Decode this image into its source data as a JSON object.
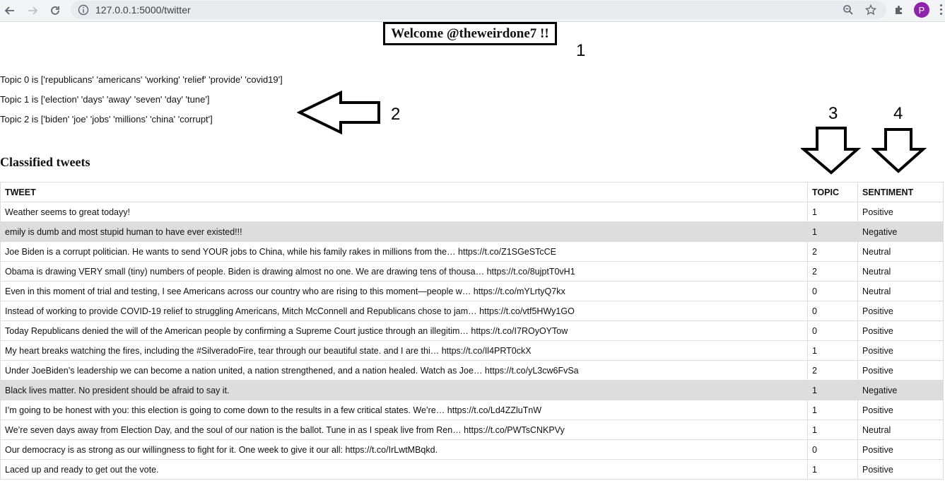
{
  "browser": {
    "url": "127.0.0.1:5000/twitter",
    "avatar_initial": "P"
  },
  "welcome": "Welcome @theweirdone7 !!",
  "annotations": [
    "1",
    "2",
    "3",
    "4"
  ],
  "topics": [
    "Topic 0 is ['republicans' 'americans' 'working' 'relief' 'provide' 'covid19']",
    "Topic 1 is ['election' 'days' 'away' 'seven' 'day' 'tune']",
    "Topic 2 is ['biden' 'joe' 'jobs' 'millions' 'china' 'corrupt']"
  ],
  "section_title": "Classified tweets",
  "table": {
    "headers": [
      "TWEET",
      "TOPIC",
      "SENTIMENT"
    ],
    "rows": [
      {
        "tweet": "Weather seems to great todayy!",
        "topic": "1",
        "sentiment": "Positive"
      },
      {
        "tweet": "emily is dumb and most stupid human to have ever existed!!!",
        "topic": "1",
        "sentiment": "Negative"
      },
      {
        "tweet": "Joe Biden is a corrupt politician. He wants to send YOUR jobs to China, while his family rakes in millions from the… https://t.co/Z1SGeSTcCE",
        "topic": "2",
        "sentiment": "Neutral"
      },
      {
        "tweet": "Obama is drawing VERY small (tiny) numbers of people. Biden is drawing almost no one. We are drawing tens of thousa… https://t.co/8ujptT0vH1",
        "topic": "2",
        "sentiment": "Neutral"
      },
      {
        "tweet": "Even in this moment of trial and testing, I see Americans across our country who are rising to this moment—people w… https://t.co/mYLrtyQ7kx",
        "topic": "0",
        "sentiment": "Neutral"
      },
      {
        "tweet": "Instead of working to provide COVID-19 relief to struggling Americans, Mitch McConnell and Republicans chose to jam… https://t.co/vtf5HWy1GO",
        "topic": "0",
        "sentiment": "Positive"
      },
      {
        "tweet": "Today Republicans denied the will of the American people by confirming a Supreme Court justice through an illegitim… https://t.co/I7ROyOYTow",
        "topic": "0",
        "sentiment": "Positive"
      },
      {
        "tweet": "My heart breaks watching the fires, including the #SilveradoFire, tear through our beautiful state. and I are thi… https://t.co/Il4PRT0ckX",
        "topic": "1",
        "sentiment": "Positive"
      },
      {
        "tweet": "Under JoeBiden’s leadership we can become a nation united, a nation strengthened, and a nation healed. Watch as Joe… https://t.co/yL3cw6FvSa",
        "topic": "2",
        "sentiment": "Positive"
      },
      {
        "tweet": "Black lives matter. No president should be afraid to say it.",
        "topic": "1",
        "sentiment": "Negative"
      },
      {
        "tweet": "I’m going to be honest with you: this election is going to come down to the results in a few critical states. We’re… https://t.co/Ld4ZZluTnW",
        "topic": "1",
        "sentiment": "Positive"
      },
      {
        "tweet": "We’re seven days away from Election Day, and the soul of our nation is the ballot. Tune in as I speak live from Ren… https://t.co/PWTsCNKPVy",
        "topic": "1",
        "sentiment": "Neutral"
      },
      {
        "tweet": "Our democracy is as strong as our willingness to fight for it. One week to give it our all: https://t.co/IrLwtMBqkd.",
        "topic": "0",
        "sentiment": "Positive"
      },
      {
        "tweet": "Laced up and ready to get out the vote.",
        "topic": "1",
        "sentiment": "Positive"
      }
    ]
  }
}
